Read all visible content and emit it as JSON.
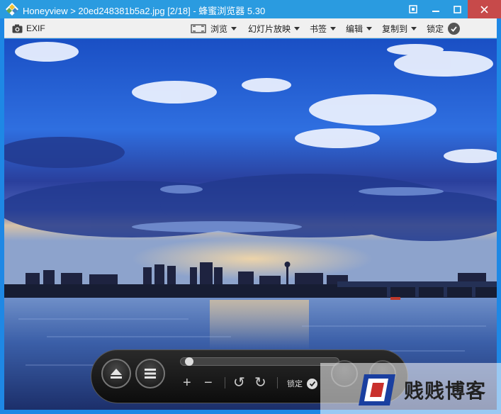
{
  "titlebar": {
    "title": "Honeyview > 20ed248381b5a2.jpg [2/18] - 蜂蜜浏览器 5.30",
    "close_color": "#c74a4a",
    "bar_color": "#2a9be0"
  },
  "toolbar": {
    "exif_label": "EXIF",
    "browse_label": "浏览",
    "slideshow_label": "幻灯片放映",
    "bookmark_label": "书签",
    "edit_label": "编辑",
    "copy_label": "复制到",
    "lock_label": "锁定"
  },
  "controls": {
    "lock_label": "锁定",
    "progress": 0.03
  },
  "icons": {
    "app": "honeyview-logo-icon",
    "pin": "pin-icon",
    "minimize": "minimize-icon",
    "maximize": "maximize-icon",
    "close": "close-icon",
    "camera": "camera-icon",
    "fullscreen": "fullscreen-icon",
    "eject": "eject-icon",
    "menu": "menu-icon",
    "zoom_in": "zoom-in-icon",
    "zoom_out": "zoom-out-icon",
    "rotate_left": "rotate-left-icon",
    "rotate_right": "rotate-right-icon",
    "check": "check-icon"
  },
  "watermark": {
    "text": "贱贱博客"
  }
}
